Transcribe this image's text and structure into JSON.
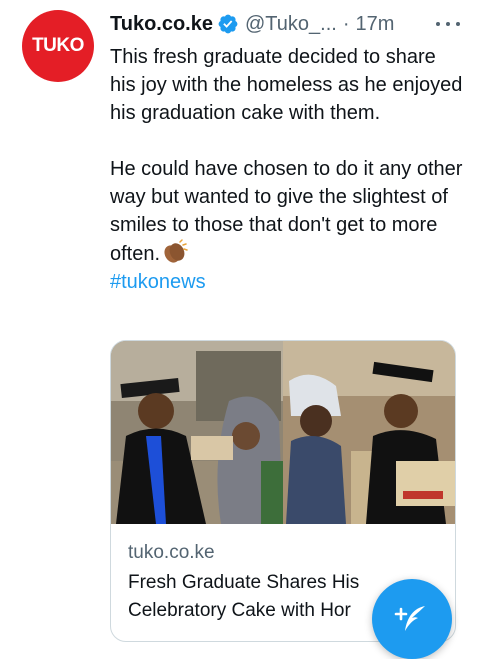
{
  "tweet": {
    "avatar": {
      "text": "TUKO",
      "color": "#e41e26"
    },
    "author": {
      "display_name": "Tuko.co.ke",
      "verified": true,
      "handle": "@Tuko_...",
      "separator": "·",
      "time": "17m"
    },
    "more_icon": "more-horizontal-icon",
    "paragraph1": "This fresh graduate decided to share his joy with the homeless as he enjoyed his graduation cake with them.",
    "paragraph2": "He could have chosen to do it any other way but wanted to give the slightest of smiles to those that don't get to more often.",
    "emoji_icon": "clapping-hands-icon",
    "hashtag": "#tukonews",
    "link_card": {
      "image_description_icon": "news-photo-icon",
      "domain": "tuko.co.ke",
      "title": "Fresh Graduate Shares His Celebratory Cake with Hor"
    }
  },
  "compose_button": {
    "icon": "compose-tweet-icon",
    "color": "#1d9bf0"
  },
  "colors": {
    "text": "#0f1419",
    "secondary": "#536471",
    "link": "#1d9bf0",
    "border": "#cfd9de"
  }
}
